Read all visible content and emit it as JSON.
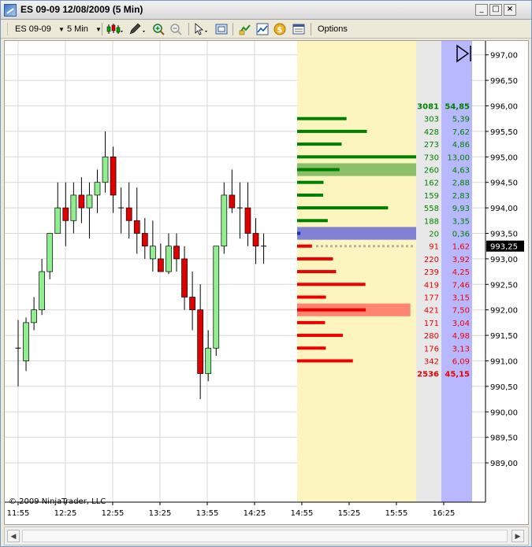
{
  "window": {
    "title": "ES 09-09  12/08/2009 (5 Min)",
    "minimize_label": "_",
    "maximize_label": "□",
    "close_label": "×"
  },
  "toolbar": {
    "instrument": "ES 09-09",
    "period": "5 Min",
    "options_label": "Options"
  },
  "colors": {
    "up_candle": "#90ee90",
    "down_candle": "#e00000",
    "ask_bar": "#008000",
    "bid_bar": "#ee0000",
    "vp_background": "#fdf5c0",
    "ask_col_bg": "#e8e8e8",
    "bid_col_bg": "#b8b8ff",
    "current_price_bg": "#000000"
  },
  "chart_data": {
    "type": "candlestick",
    "copyright": "© 2009 NinjaTrader, LLC",
    "current_price": "993,25",
    "x_ticks": [
      "11:55",
      "12:25",
      "12:55",
      "13:25",
      "13:55",
      "14:25",
      "14:55",
      "15:25",
      "15:55",
      "16:25"
    ],
    "y_ticks": [
      "997,00",
      "996,50",
      "996,00",
      "995,50",
      "995,00",
      "994,50",
      "994,00",
      "993,50",
      "993,00",
      "992,50",
      "992,00",
      "991,50",
      "991,00",
      "990,50",
      "990,00",
      "989,50",
      "989,00"
    ],
    "y_range": [
      988.6,
      997.15
    ],
    "candles": [
      {
        "o": 991.25,
        "h": 991.8,
        "l": 990.5,
        "c": 991.25
      },
      {
        "o": 991.0,
        "h": 991.85,
        "l": 990.8,
        "c": 991.75
      },
      {
        "o": 991.75,
        "h": 992.25,
        "l": 991.6,
        "c": 992.0
      },
      {
        "o": 992.0,
        "h": 993.0,
        "l": 991.9,
        "c": 992.75
      },
      {
        "o": 992.75,
        "h": 993.5,
        "l": 992.6,
        "c": 993.5
      },
      {
        "o": 993.5,
        "h": 994.5,
        "l": 993.5,
        "c": 994.0
      },
      {
        "o": 994.0,
        "h": 994.5,
        "l": 993.25,
        "c": 993.75
      },
      {
        "o": 993.75,
        "h": 994.5,
        "l": 993.5,
        "c": 994.25
      },
      {
        "o": 994.25,
        "h": 994.6,
        "l": 993.7,
        "c": 994.0
      },
      {
        "o": 994.0,
        "h": 994.5,
        "l": 993.4,
        "c": 994.25
      },
      {
        "o": 994.25,
        "h": 994.75,
        "l": 993.9,
        "c": 994.5
      },
      {
        "o": 994.5,
        "h": 995.5,
        "l": 994.3,
        "c": 995.0
      },
      {
        "o": 995.0,
        "h": 995.2,
        "l": 993.9,
        "c": 994.25
      },
      {
        "o": 994.0,
        "h": 994.4,
        "l": 993.5,
        "c": 994.0
      },
      {
        "o": 994.0,
        "h": 994.5,
        "l": 993.4,
        "c": 993.75
      },
      {
        "o": 993.75,
        "h": 994.4,
        "l": 993.1,
        "c": 993.5
      },
      {
        "o": 993.5,
        "h": 993.8,
        "l": 993.0,
        "c": 993.25
      },
      {
        "o": 993.0,
        "h": 993.75,
        "l": 992.75,
        "c": 993.25
      },
      {
        "o": 993.0,
        "h": 993.3,
        "l": 992.75,
        "c": 992.75
      },
      {
        "o": 992.75,
        "h": 993.5,
        "l": 992.7,
        "c": 993.25
      },
      {
        "o": 993.25,
        "h": 993.5,
        "l": 992.75,
        "c": 993.0
      },
      {
        "o": 993.0,
        "h": 993.25,
        "l": 992.0,
        "c": 992.25
      },
      {
        "o": 992.25,
        "h": 992.75,
        "l": 991.6,
        "c": 992.0
      },
      {
        "o": 992.0,
        "h": 992.5,
        "l": 990.25,
        "c": 990.75
      },
      {
        "o": 990.75,
        "h": 991.6,
        "l": 990.6,
        "c": 991.25
      },
      {
        "o": 991.25,
        "h": 993.25,
        "l": 991.1,
        "c": 993.25
      },
      {
        "o": 993.25,
        "h": 994.5,
        "l": 993.1,
        "c": 994.25
      },
      {
        "o": 994.25,
        "h": 994.75,
        "l": 993.9,
        "c": 994.0
      },
      {
        "o": 994.0,
        "h": 994.5,
        "l": 993.4,
        "c": 994.0
      },
      {
        "o": 994.0,
        "h": 994.5,
        "l": 993.25,
        "c": 993.5
      },
      {
        "o": 993.5,
        "h": 993.8,
        "l": 992.9,
        "c": 993.25
      },
      {
        "o": 993.25,
        "h": 993.5,
        "l": 992.9,
        "c": 993.25
      }
    ],
    "volume_profile": {
      "ask_total": "3081",
      "ask_pct_total": "54,85",
      "bid_total": "2536",
      "bid_pct_total": "45,15",
      "levels": [
        {
          "price": 995.75,
          "side": "ask",
          "volume": 303,
          "vol_label": "303",
          "pct": "5,39"
        },
        {
          "price": 995.5,
          "side": "ask",
          "volume": 428,
          "vol_label": "428",
          "pct": "7,62"
        },
        {
          "price": 995.25,
          "side": "ask",
          "volume": 273,
          "vol_label": "273",
          "pct": "4,86"
        },
        {
          "price": 995.0,
          "side": "ask",
          "volume": 730,
          "vol_label": "730",
          "pct": "13,00"
        },
        {
          "price": 994.75,
          "side": "ask",
          "volume": 260,
          "vol_label": "260",
          "pct": "4,63",
          "highlight": true
        },
        {
          "price": 994.5,
          "side": "ask",
          "volume": 162,
          "vol_label": "162",
          "pct": "2,88"
        },
        {
          "price": 994.25,
          "side": "ask",
          "volume": 159,
          "vol_label": "159",
          "pct": "2,83"
        },
        {
          "price": 994.0,
          "side": "ask",
          "volume": 558,
          "vol_label": "558",
          "pct": "9,93"
        },
        {
          "price": 993.75,
          "side": "ask",
          "volume": 188,
          "vol_label": "188",
          "pct": "3,35"
        },
        {
          "price": 993.5,
          "side": "ask",
          "volume": 20,
          "vol_label": "20",
          "pct": "0,36",
          "current": true
        },
        {
          "price": 993.25,
          "side": "bid",
          "volume": 91,
          "vol_label": "91",
          "pct": "1,62"
        },
        {
          "price": 993.0,
          "side": "bid",
          "volume": 220,
          "vol_label": "220",
          "pct": "3,92"
        },
        {
          "price": 992.75,
          "side": "bid",
          "volume": 239,
          "vol_label": "239",
          "pct": "4,25"
        },
        {
          "price": 992.5,
          "side": "bid",
          "volume": 419,
          "vol_label": "419",
          "pct": "7,46"
        },
        {
          "price": 992.25,
          "side": "bid",
          "volume": 177,
          "vol_label": "177",
          "pct": "3,15"
        },
        {
          "price": 992.0,
          "side": "bid",
          "volume": 421,
          "vol_label": "421",
          "pct": "7,50",
          "highlight": true
        },
        {
          "price": 991.75,
          "side": "bid",
          "volume": 171,
          "vol_label": "171",
          "pct": "3,04"
        },
        {
          "price": 991.5,
          "side": "bid",
          "volume": 280,
          "vol_label": "280",
          "pct": "4,98"
        },
        {
          "price": 991.25,
          "side": "bid",
          "volume": 176,
          "vol_label": "176",
          "pct": "3,13"
        },
        {
          "price": 991.0,
          "side": "bid",
          "volume": 342,
          "vol_label": "342",
          "pct": "6,09"
        }
      ]
    }
  }
}
